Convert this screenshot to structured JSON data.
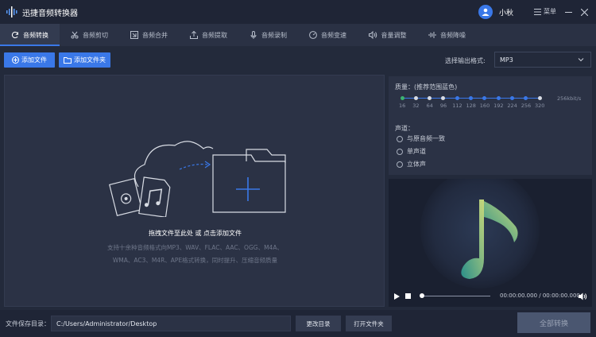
{
  "app": {
    "title": "迅捷音频转换器",
    "user_name": "小秋",
    "menu_label": "菜单"
  },
  "tabs": [
    {
      "label": "音频转换",
      "icon": "refresh-icon",
      "active": true
    },
    {
      "label": "音频剪切",
      "icon": "scissors-icon",
      "active": false
    },
    {
      "label": "音频合并",
      "icon": "merge-icon",
      "active": false
    },
    {
      "label": "音频提取",
      "icon": "extract-icon",
      "active": false
    },
    {
      "label": "音频录制",
      "icon": "microphone-icon",
      "active": false
    },
    {
      "label": "音频变速",
      "icon": "speed-icon",
      "active": false
    },
    {
      "label": "音量调整",
      "icon": "volume-icon",
      "active": false
    },
    {
      "label": "音频降噪",
      "icon": "noise-reduction-icon",
      "active": false
    }
  ],
  "toolbar": {
    "add_file": "添加文件",
    "add_folder": "添加文件夹",
    "format_label": "选择输出格式:",
    "format_value": "MP3"
  },
  "dropzone": {
    "title": "拖拽文件至此处 或 点击添加文件",
    "desc_line1": "支持十余种音频格式向MP3、WAV、FLAC、AAC、OGG、M4A、",
    "desc_line2": "WMA、AC3、M4R、APE格式转换，同时提升、压缩音频质量"
  },
  "quality": {
    "label": "质量：(推荐范围蓝色)",
    "ticks": [
      "16",
      "32",
      "64",
      "96",
      "112",
      "128",
      "160",
      "192",
      "224",
      "256",
      "320"
    ],
    "selected_index": 0,
    "unit_text": "256kbit/s"
  },
  "channel": {
    "label": "声道：",
    "options": [
      "与原音频一致",
      "单声道",
      "立体声"
    ]
  },
  "player": {
    "time_text": "00:00:00.000 / 00:00:00.000",
    "progress": 0
  },
  "bottom": {
    "save_label": "文件保存目录：",
    "path_value": "C:/Users/Administrator/Desktop",
    "change_dir": "更改目录",
    "open_folder": "打开文件夹",
    "convert_all": "全部转换"
  },
  "colors": {
    "accent": "#3a78e8",
    "bg": "#232a3b",
    "panel": "#2b3245",
    "green": "#3cb371"
  }
}
